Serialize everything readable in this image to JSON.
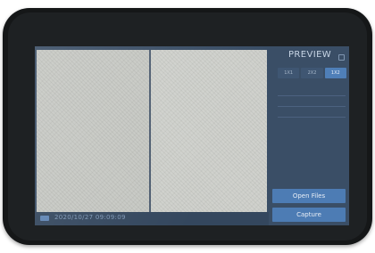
{
  "preview": {
    "title": "PREVIEW",
    "modes": [
      {
        "label": "1X1",
        "active": false
      },
      {
        "label": "2X2",
        "active": false
      },
      {
        "label": "1X2",
        "active": true
      }
    ],
    "settings": [
      {
        "label": "",
        "caret": ""
      },
      {
        "label": "",
        "caret": ""
      },
      {
        "label": "",
        "caret": ""
      }
    ],
    "open_files_label": "Open Files",
    "capture_label": "Capture"
  },
  "status": {
    "timestamp": "2020/10/27 09:09:09"
  },
  "colors": {
    "bezel": "#151718",
    "screen_background": "#3a4e66",
    "accent_button": "#4d7cb4"
  },
  "icons": {
    "menu": "menu-icon",
    "status": "camera-status-icon"
  }
}
